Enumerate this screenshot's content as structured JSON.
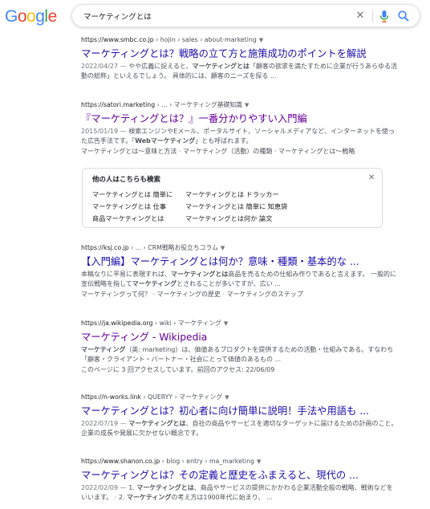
{
  "logo": {
    "letters": [
      "G",
      "o",
      "o",
      "g",
      "l",
      "e"
    ],
    "colors": [
      "#4285f4",
      "#ea4335",
      "#fbbc05",
      "#4285f4",
      "#34a853",
      "#ea4335"
    ]
  },
  "search": {
    "query": "マーケティングとは",
    "clear_icon": "close-icon",
    "mic_icon": "mic-icon",
    "search_icon": "search-icon"
  },
  "results": [
    {
      "domain": "https://www.smbc.co.jp",
      "path": " › hojin › sales › about-marketing",
      "title": "マーケティングとは？戦略の立て方と施策成功のポイントを解説",
      "date": "2022/04/27 — ",
      "s1": "やや広義に捉えると、",
      "b1": "マーケティングとは",
      "s2": "「顧客の欲求を満たすために企業が行うあらゆる活動の総称」といえるでしょう。 具体的には、顧客のニーズを探る ..."
    },
    {
      "domain": "https://satori.marketing",
      "path": " › ... › マーケティング基礎知識",
      "title": "『マーケティングとは？』一番分かりやすい入門編",
      "date": "2015/01/19 — ",
      "s1": "検索エンジンやEメール、ポータルサイト、ソーシャルメディアなど、インターネットを使った広告手法です。「",
      "b1": "Webマーケティング",
      "s2": "」とも呼ばれます。",
      "links": "マーケティングとは〜意味と方法 · マーケティング（活動）の種類 · マーケティングとは〜戦略"
    },
    {
      "domain": "https://ksj.co.jp",
      "path": " › ... › CRM戦略お役立ちコラム",
      "title": "【入門編】マーケティングとは何か？意味・種類・基本的な ...",
      "s1": "本稿なりに平易に表現すれば、",
      "b1": "マーケティングとは",
      "s2": "商品を売るための仕組み作りであると言えます。 一般的に宣伝戦略を指して",
      "b2": "マーケティング",
      "s3": "とされることが多いですが、広い ...",
      "links": "マーケティングって何？ · マーケティングの歴史 · マーケティングのステップ"
    },
    {
      "domain": "https://ja.wikipedia.org",
      "path": " › wiki › マーケティング",
      "title": "マーケティング - Wikipedia",
      "b1": "マーケティング",
      "s1": "（英: marketing）は、価値あるプロダクトを提供するための活動・仕組みである。すなわち「顧客・クライアント・パートナー・社会にとって価値のあるもの ...",
      "visit": "このページに 3 回アクセスしています。前回のアクセス: 22/06/09"
    },
    {
      "domain": "https://n-works.link",
      "path": " › QUERYY › マーケティング",
      "title": "マーケティングとは？初心者に向け簡単に説明！手法や用語も ...",
      "date": "2022/07/19 — ",
      "b1": "マーケティングとは",
      "s1": "、自社の商品やサービスを適切なターゲットに届けるための計画のこと。企業の成長や発展に欠かせない概念です。"
    },
    {
      "domain": "https://www.shanon.co.jp",
      "path": " › blog › entry › ma_marketing",
      "title": "マーケティングとは？その定義と歴史をふまえると、現代の ...",
      "date": "2022/02/09 — ",
      "s1": "1. ",
      "b1": "マーケティングとは",
      "s2": "、商品やサービスの提供にかかわる企業活動全般の戦略、戦術などをいいます。 · 2. ",
      "b2": "マーケティング",
      "s3": "の考え方は1900年代に始まり、 ..."
    }
  ],
  "paa": {
    "title": "他の人はこちらも検索",
    "items": [
      "マーケティングとは 簡単に",
      "マーケティングとは ドラッカー",
      "マーケティングとは 仕事",
      "マーケティングとは 簡単に 知恵袋",
      "商品マーケティングとは",
      "マーケティングとは何か 論文"
    ]
  }
}
